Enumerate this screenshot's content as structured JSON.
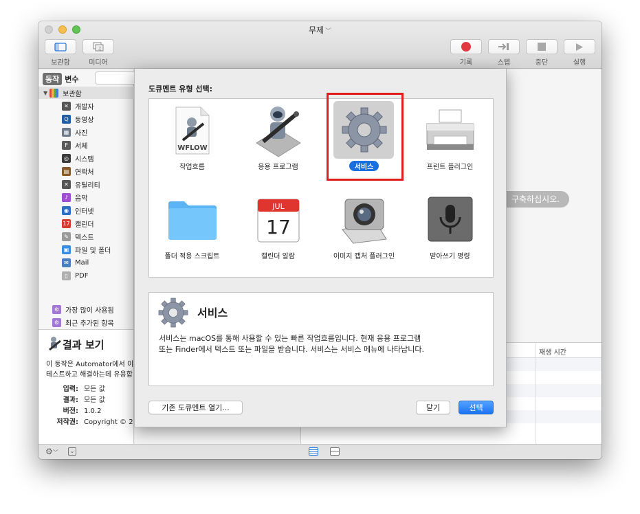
{
  "window": {
    "title": "무제"
  },
  "toolbar": {
    "left_buttons": [
      {
        "label": "보관함",
        "icon": "library-panel-icon"
      },
      {
        "label": "미디어",
        "icon": "media-icon"
      }
    ],
    "right_buttons": [
      {
        "label": "기록",
        "icon": "record-icon"
      },
      {
        "label": "스텝",
        "icon": "step-icon"
      },
      {
        "label": "중단",
        "icon": "stop-icon"
      },
      {
        "label": "실행",
        "icon": "run-icon"
      }
    ]
  },
  "sidebar": {
    "tabs": [
      "동작",
      "변수"
    ],
    "library_label": "보관함",
    "items": [
      {
        "label": "개발자",
        "color": "#555555",
        "glyph": "✕"
      },
      {
        "label": "동영상",
        "color": "#1f5fa8",
        "glyph": "Q"
      },
      {
        "label": "사진",
        "color": "#6d7a8a",
        "glyph": "▦"
      },
      {
        "label": "서체",
        "color": "#5b5b5b",
        "glyph": "F"
      },
      {
        "label": "시스템",
        "color": "#3a3a3a",
        "glyph": "◎"
      },
      {
        "label": "연락처",
        "color": "#8b5a2b",
        "glyph": "▤"
      },
      {
        "label": "유틸리티",
        "color": "#555555",
        "glyph": "✕"
      },
      {
        "label": "음악",
        "color": "#a24bd8",
        "glyph": "♪"
      },
      {
        "label": "인터넷",
        "color": "#2c6fc4",
        "glyph": "◉"
      },
      {
        "label": "캘린더",
        "color": "#d83a2e",
        "glyph": "17"
      },
      {
        "label": "텍스트",
        "color": "#9a9a9a",
        "glyph": "✎"
      },
      {
        "label": "파일 및 폴더",
        "color": "#3b8de0",
        "glyph": "▣"
      },
      {
        "label": "Mail",
        "color": "#4a7fc1",
        "glyph": "✉"
      },
      {
        "label": "PDF",
        "color": "#b0b0b0",
        "glyph": "▯"
      }
    ],
    "smart_groups": [
      {
        "label": "가장 많이 사용됨"
      },
      {
        "label": "최근 추가된 항목"
      }
    ]
  },
  "info_panel": {
    "title": "결과 보기",
    "desc_line1": "이 동작은 Automator에서 이",
    "desc_line2": "테스트하고 해결하는데 유용합",
    "meta": [
      {
        "key": "입력:",
        "value": "모든 값"
      },
      {
        "key": "결과:",
        "value": "모든 값"
      },
      {
        "key": "버전:",
        "value": "1.0.2"
      },
      {
        "key": "저작권:",
        "value": "Copyright © 2"
      }
    ]
  },
  "main": {
    "hint": "구축하십시오.",
    "log_column": "재생 시간"
  },
  "dialog": {
    "title": "도큐멘트 유형 선택:",
    "types": [
      {
        "label": "작업흐름",
        "icon": "workflow-file-icon",
        "file_tag": "WFLOW"
      },
      {
        "label": "응용 프로그램",
        "icon": "application-robot-icon"
      },
      {
        "label": "서비스",
        "icon": "gear-icon",
        "selected": true
      },
      {
        "label": "프린트 플러그인",
        "icon": "printer-icon"
      },
      {
        "label": "폴더 적용 스크립트",
        "icon": "folder-icon"
      },
      {
        "label": "캘린더 알람",
        "icon": "calendar-icon",
        "month": "JUL",
        "day": "17"
      },
      {
        "label": "이미지 캡처 플러그인",
        "icon": "camera-icon"
      },
      {
        "label": "받아쓰기 명령",
        "icon": "microphone-icon"
      }
    ],
    "description": {
      "title": "서비스",
      "line1": "서비스는 macOS를 통해 사용할 수 있는 빠른 작업흐름입니다. 현재 응용 프로그램",
      "line2": "또는 Finder에서 텍스트 또는 파일을 받습니다. 서비스는 서비스 메뉴에 나타납니다."
    },
    "open_existing_label": "기존 도큐멘트 열기...",
    "close_label": "닫기",
    "choose_label": "선택"
  }
}
